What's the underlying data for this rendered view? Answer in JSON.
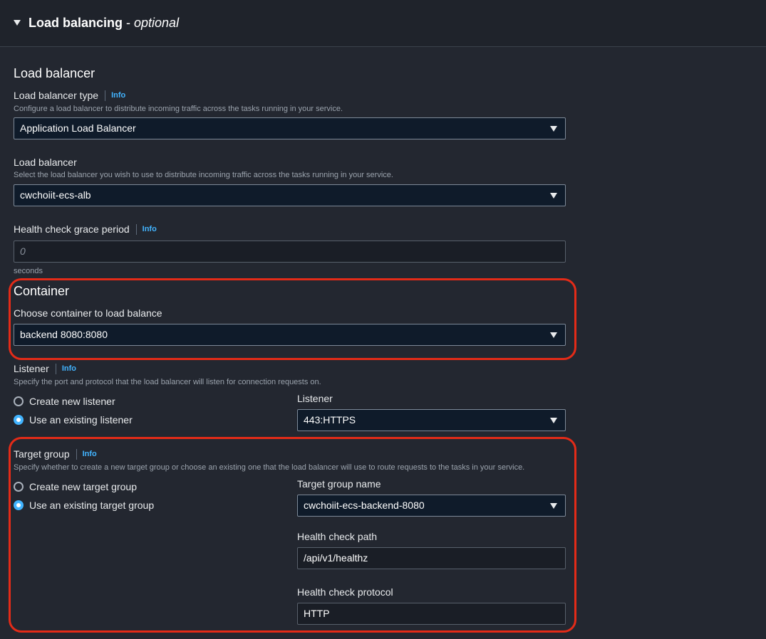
{
  "header": {
    "title": "Load balancing",
    "separator": " - ",
    "optional": "optional"
  },
  "load_balancer": {
    "heading": "Load balancer",
    "type_label": "Load balancer type",
    "type_info": "Info",
    "type_desc": "Configure a load balancer to distribute incoming traffic across the tasks running in your service.",
    "type_value": "Application Load Balancer",
    "lb_label": "Load balancer",
    "lb_desc": "Select the load balancer you wish to use to distribute incoming traffic across the tasks running in your service.",
    "lb_value": "cwchoiit-ecs-alb",
    "grace_label": "Health check grace period",
    "grace_info": "Info",
    "grace_placeholder": "0",
    "grace_unit": "seconds"
  },
  "container": {
    "heading": "Container",
    "choose_label": "Choose container to load balance",
    "value": "backend 8080:8080"
  },
  "listener": {
    "label": "Listener",
    "info": "Info",
    "desc": "Specify the port and protocol that the load balancer will listen for connection requests on.",
    "options": [
      "Create new listener",
      "Use an existing listener"
    ],
    "select_label": "Listener",
    "select_value": "443:HTTPS"
  },
  "target_group": {
    "label": "Target group",
    "info": "Info",
    "desc": "Specify whether to create a new target group or choose an existing one that the load balancer will use to route requests to the tasks in your service.",
    "options": [
      "Create new target group",
      "Use an existing target group"
    ],
    "name_label": "Target group name",
    "name_value": "cwchoiit-ecs-backend-8080",
    "path_label": "Health check path",
    "path_value": "/api/v1/healthz",
    "protocol_label": "Health check protocol",
    "protocol_value": "HTTP"
  },
  "colors": {
    "background": "#232730",
    "accent": "#42b4ff",
    "highlight": "#e32b18"
  }
}
